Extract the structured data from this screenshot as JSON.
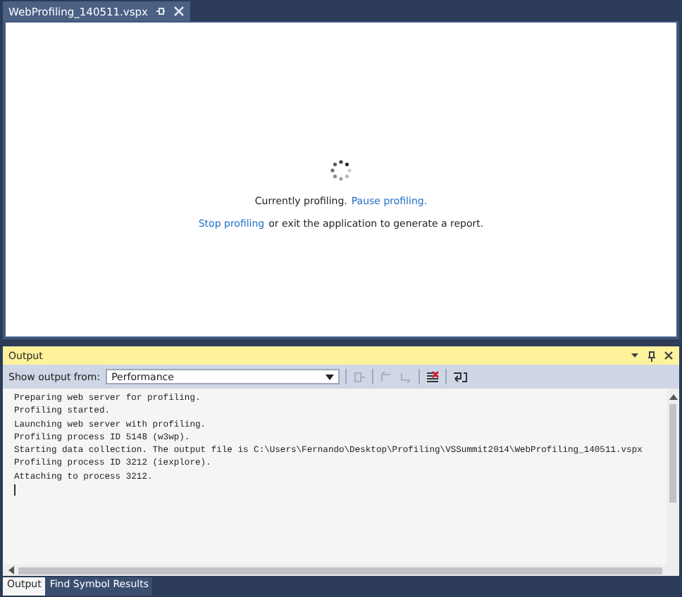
{
  "document_tab": {
    "title": "WebProfiling_140511.vspx",
    "selected": true
  },
  "profiling": {
    "status": "Currently profiling.",
    "pause_link": "Pause profiling.",
    "stop_link": "Stop profiling",
    "stop_rest": "or exit the application to generate a report."
  },
  "output": {
    "title": "Output",
    "show_from_label": "Show output from:",
    "source": "Performance",
    "lines": [
      "Preparing web server for profiling.",
      "Profiling started.",
      "Launching web server with profiling.",
      "Profiling process ID 5148 (w3wp).",
      "Starting data collection. The output file is C:\\Users\\Fernando\\Desktop\\Profiling\\VSSummit2014\\WebProfiling_140511.vspx",
      "Profiling process ID 3212 (iexplore).",
      "Attaching to process 3212."
    ]
  },
  "bottom_tabs": [
    {
      "label": "Output",
      "selected": true
    },
    {
      "label": "Find Symbol Results",
      "selected": false
    }
  ]
}
